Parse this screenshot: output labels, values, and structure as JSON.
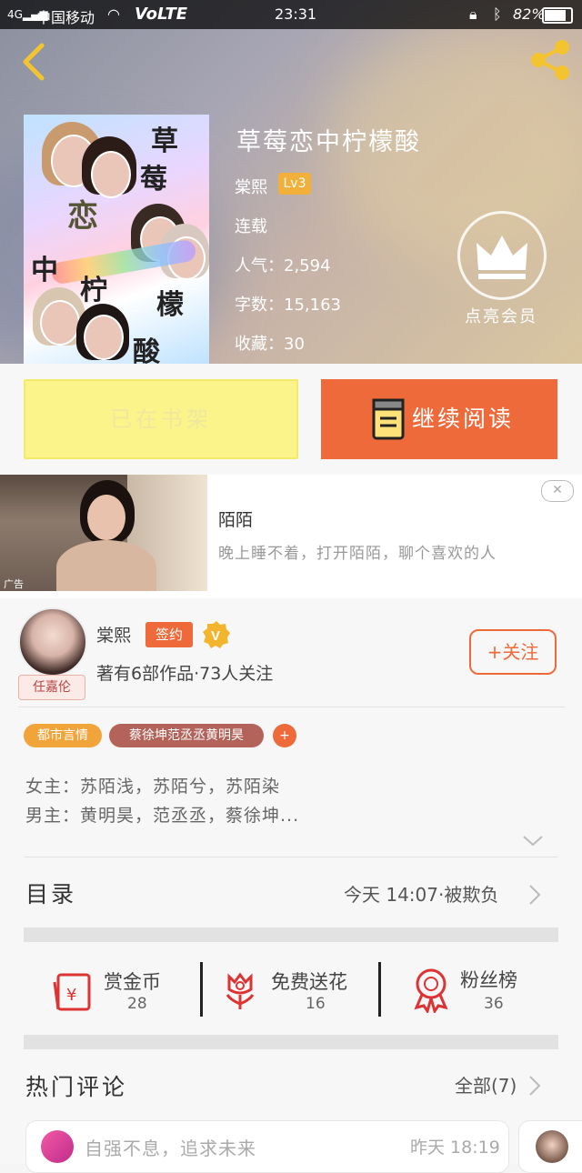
{
  "status_bar": {
    "carrier": "中国移动",
    "network": "VoLTE",
    "time": "23:31",
    "battery": "82%"
  },
  "book": {
    "title": "草莓恋中柠檬酸",
    "author": "棠熙",
    "level": "Lv3",
    "status": "连载",
    "popularity": "人气：2,594",
    "word_count": "字数：15,163",
    "favorites": "收藏：30",
    "cover_text": [
      "草",
      "莓",
      "恋",
      "中",
      "柠",
      "檬",
      "酸"
    ]
  },
  "vip": {
    "label": "点亮会员"
  },
  "actions": {
    "shelf_label": "已在书架",
    "read_label": "继续阅读"
  },
  "ad": {
    "title": "陌陌",
    "desc": "晚上睡不着，打开陌陌，聊个喜欢的人",
    "badge": "广告"
  },
  "author": {
    "name": "棠熙",
    "signed_badge": "签约",
    "avatar_tag": "任嘉伦",
    "stats": "著有6部作品·73人关注",
    "follow_label": "+关注"
  },
  "tags": [
    "都市言情",
    "蔡徐坤范丞丞黄明昊",
    "+"
  ],
  "summary": {
    "line1": "女主：苏陌浅，苏陌兮，苏陌染",
    "line2": "男主：黄明昊，范丞丞，蔡徐坤..."
  },
  "catalog": {
    "label": "目录",
    "latest": "今天 14:07·被欺负"
  },
  "rewards": [
    {
      "label": "赏金币",
      "count": "28"
    },
    {
      "label": "免费送花",
      "count": "16"
    },
    {
      "label": "粉丝榜",
      "count": "36"
    }
  ],
  "comments": {
    "title": "热门评论",
    "all_label": "全部(7)",
    "first": {
      "text": "自强不息，追求未来",
      "time": "昨天 18:19"
    }
  },
  "colors": {
    "accent": "#ee6a3a",
    "shelf": "#fbf48a",
    "tag_orange": "#f0a43a",
    "tag_brown": "#b3635a"
  }
}
